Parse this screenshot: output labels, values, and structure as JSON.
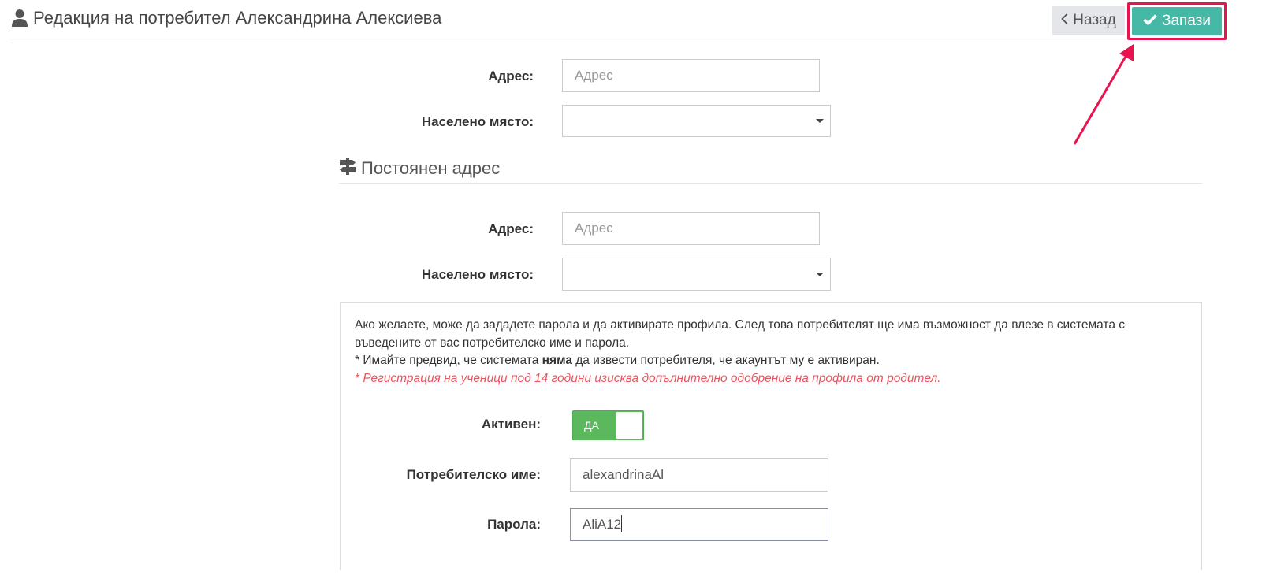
{
  "header": {
    "title": "Редакция на потребител Александрина Алексиева",
    "back_label": "Назад",
    "save_label": "Запази"
  },
  "current_address": {
    "address_label": "Адрес:",
    "address_placeholder": "Адрес",
    "address_value": "",
    "city_label": "Населено място:",
    "city_value": ""
  },
  "permanent_address": {
    "section_title": "Постоянен адрес",
    "address_label": "Адрес:",
    "address_placeholder": "Адрес",
    "address_value": "",
    "city_label": "Населено място:",
    "city_value": ""
  },
  "account": {
    "info_line1": "Ако желаете, може да зададете парола и да активирате профила. След това потребителят ще има възможност да влезе в системата с въведените от вас потребителско име и парола.",
    "info_line2_prefix": "* Имайте предвид, че системата ",
    "info_line2_bold": "няма",
    "info_line2_suffix": " да извести потребителя, че акаунтът му е активиран.",
    "info_warning": "* Регистрация на ученици под 14 години изисква допълнително одобрение на профила от родител.",
    "active_label": "Активен:",
    "active_toggle_text": "ДА",
    "active": true,
    "username_label": "Потребителско име:",
    "username_value": "alexandrinaAl",
    "password_label": "Парола:",
    "password_value": "AliA12"
  },
  "colors": {
    "save_button": "#46b8a6",
    "annotation": "#e8144f",
    "toggle_on": "#5cb85c",
    "warning_text": "#e8555f"
  },
  "icons": {
    "header": "user-icon",
    "back": "chevron-left-icon",
    "save": "check-icon",
    "section": "signpost-icon",
    "select": "caret-down-icon"
  }
}
